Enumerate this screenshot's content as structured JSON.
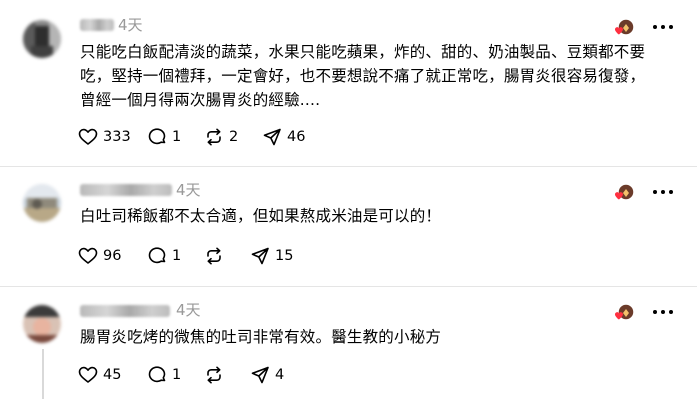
{
  "comments": [
    {
      "time": "4天",
      "lines": [
        "只能吃白飯配清淡的蔬菜，水果只能吃蘋果，炸的、甜的、奶油製品、豆類都不要",
        "吃，堅持一個禮拜，一定會好，也不要想說不痛了就正常吃，腸胃炎很容易復發，",
        "曾經一個月得兩次腸胃炎的經驗...."
      ],
      "likes": "333",
      "replies": "1",
      "reposts": "2",
      "shares": "46"
    },
    {
      "time": "4天",
      "lines": [
        "白吐司稀飯都不太合適，但如果熬成米油是可以的！"
      ],
      "likes": "96",
      "replies": "1",
      "reposts": "",
      "shares": "15"
    },
    {
      "time": "4天",
      "lines": [
        "腸胃炎吃烤的微焦的吐司非常有效。醫生教的小秘方"
      ],
      "likes": "45",
      "replies": "1",
      "reposts": "",
      "shares": "4"
    }
  ],
  "icons": {
    "like": "heart-icon",
    "reply": "comment-icon",
    "repost": "repost-icon",
    "share": "share-icon",
    "more": "more-options-icon",
    "reaction": "reaction-heart-avatar-icon"
  },
  "colors": {
    "like_reaction": "#ff3040",
    "text": "#000000",
    "muted": "#999999",
    "divider": "#e5e5e5"
  }
}
